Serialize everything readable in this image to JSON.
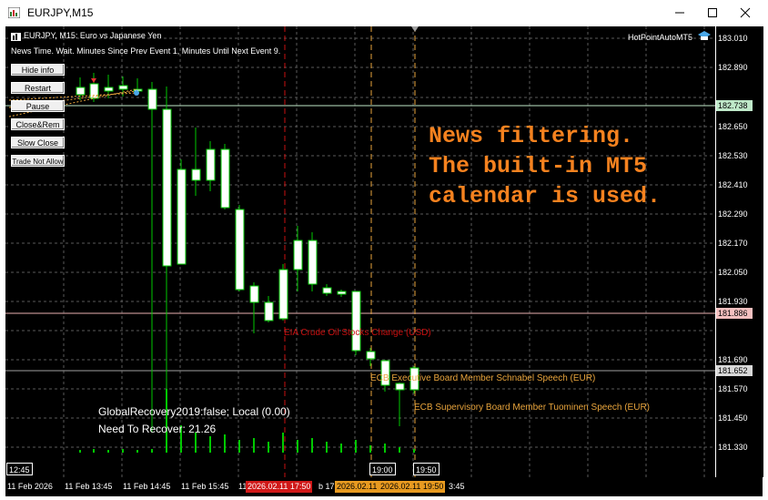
{
  "window": {
    "title": "EURJPY,M15",
    "minimize_icon": "minimize-icon",
    "maximize_icon": "maximize-icon",
    "close_icon": "close-icon"
  },
  "chart_header": {
    "symbol_line": "EURJPY, M15:  Euro vs Japanese Yen",
    "status_line": "News Time. Wait. Minutes Since Prev Event 1, Minutes Until Next Event 9.",
    "expert_name": "HotPointAutoMT5",
    "expert_icon": "graduation-cap-icon"
  },
  "panel_buttons": [
    "Hide info",
    "Restart",
    "Pause",
    "Close&Rem",
    "Slow Close",
    "Trade Not Allow"
  ],
  "overlay_text": "News filtering.\nThe built-in MT5\ncalendar is used.",
  "news_events": {
    "red": "EIA Crude Oil Stocks Change (USD)",
    "orange_1": "ECB Executive Board Member Schnabel Speech (EUR)",
    "orange_2": "ECB Supervisory Board Member Tuominen Speech (EUR)"
  },
  "info": {
    "line1": "GlobalRecovery2019:false; Local (0.00)",
    "line2": "Need To Recover: 21.26"
  },
  "price_axis": {
    "labels": [
      "183.010",
      "182.890",
      "182.650",
      "182.530",
      "182.410",
      "182.290",
      "182.170",
      "182.050",
      "181.930",
      "181.690",
      "181.570",
      "181.450",
      "181.330"
    ],
    "badges": {
      "current": "182.738",
      "line_red": "181.886",
      "line_grey": "181.652"
    }
  },
  "time_axis": {
    "labels": [
      "11 Feb 2026",
      "11 Feb 13:45",
      "11 Feb 14:45",
      "11 Feb 15:45",
      "11",
      "b 17",
      "3:45"
    ],
    "badges": [
      "2026.02.11 17:50",
      "2026.02.11 19:00",
      "2026.02.11 19:50"
    ],
    "boxes": [
      "12:45",
      "19:00",
      "19:50"
    ]
  },
  "colors": {
    "background": "#000000",
    "bull_candle": "#ffffff",
    "candle_outline": "#00c800",
    "volume": "#00c800",
    "grid": "#5a5a5a",
    "overlay": "#f5821f",
    "news_red": "#c81010",
    "news_orange": "#e8a43c"
  }
}
